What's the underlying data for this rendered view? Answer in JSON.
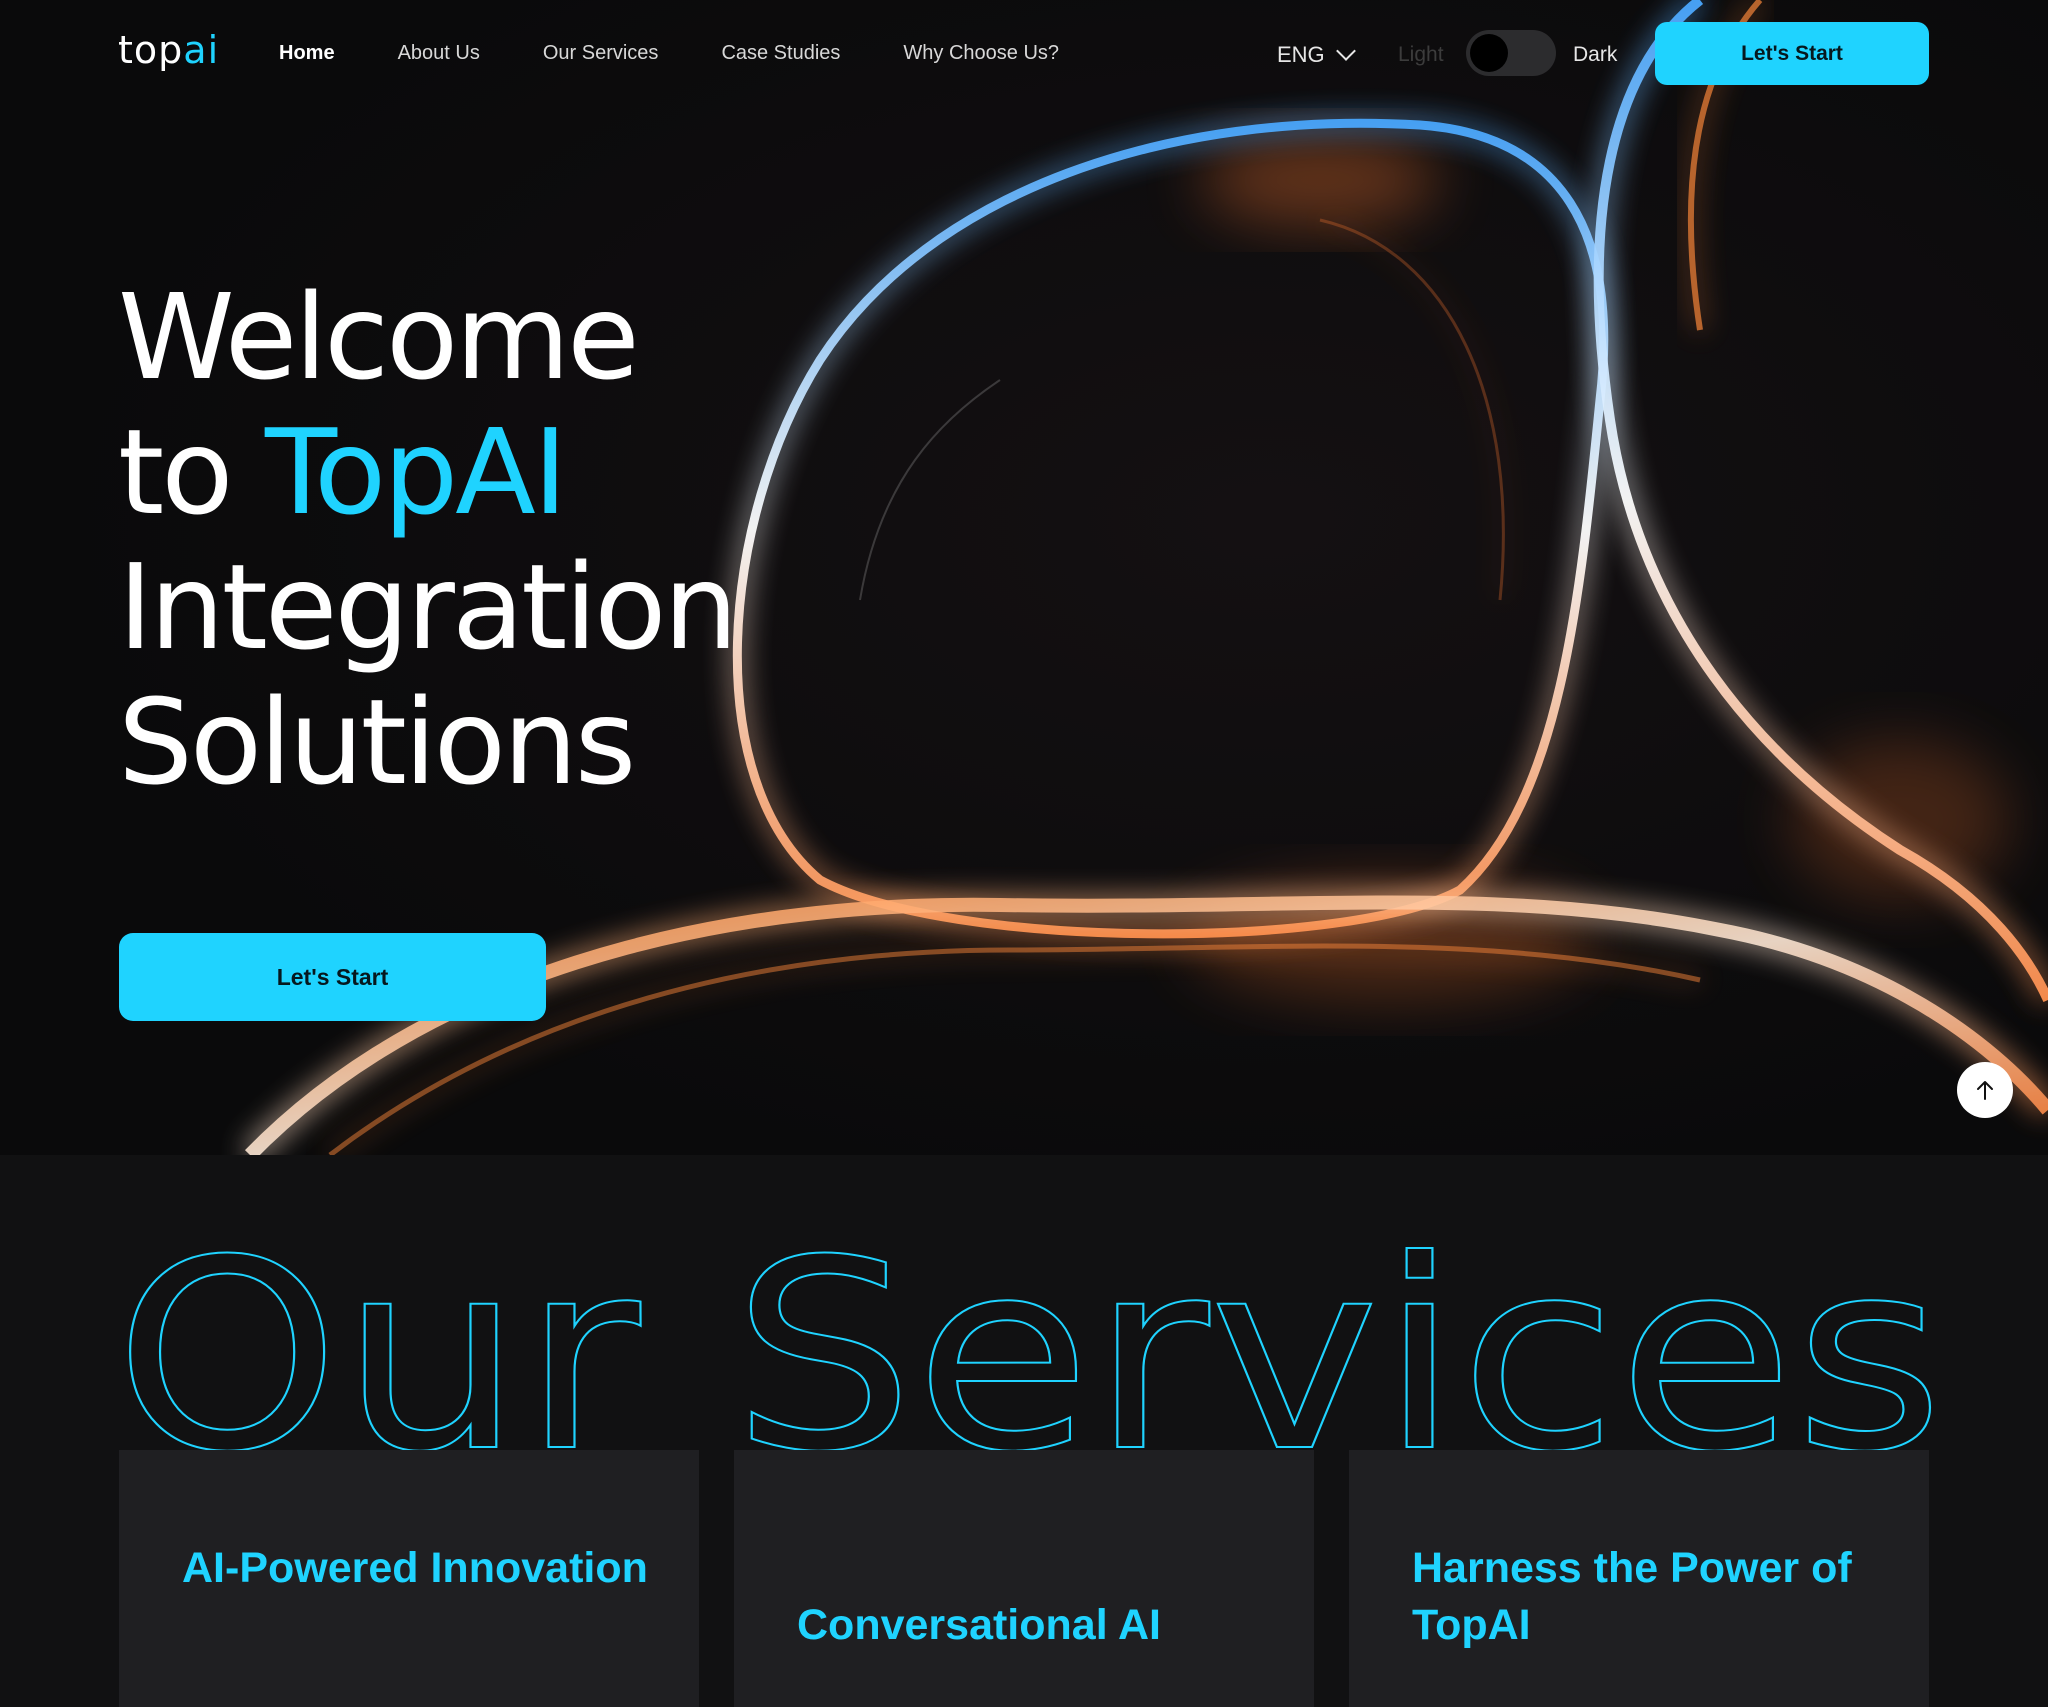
{
  "nav": {
    "logo_prefix": "top",
    "logo_suffix": "ai",
    "links": [
      {
        "label": "Home",
        "active": true
      },
      {
        "label": "About Us"
      },
      {
        "label": "Our Services"
      },
      {
        "label": "Case Studies"
      },
      {
        "label": "Why Choose Us?"
      }
    ],
    "language": "ENG",
    "theme_light_label": "Light",
    "theme_dark_label": "Dark",
    "theme_mode": "dark",
    "cta_label": "Let's Start"
  },
  "hero": {
    "title_line1": "Welcome",
    "title_line2_prefix": "to ",
    "title_line2_accent": "TopAI",
    "title_line3": "Integration",
    "title_line4": "Solutions",
    "cta_label": "Let's Start"
  },
  "services": {
    "heading": "Our Services",
    "cards": [
      {
        "title": "AI-Powered Innovation"
      },
      {
        "title": "Conversational AI"
      },
      {
        "title": "Harness the Power of TopAI"
      }
    ]
  },
  "colors": {
    "accent": "#1fd3ff",
    "background": "#111112",
    "card": "#1f1f22"
  },
  "icons": {
    "language_dropdown": "chevron-down-icon",
    "scroll_top": "arrow-up-icon"
  }
}
